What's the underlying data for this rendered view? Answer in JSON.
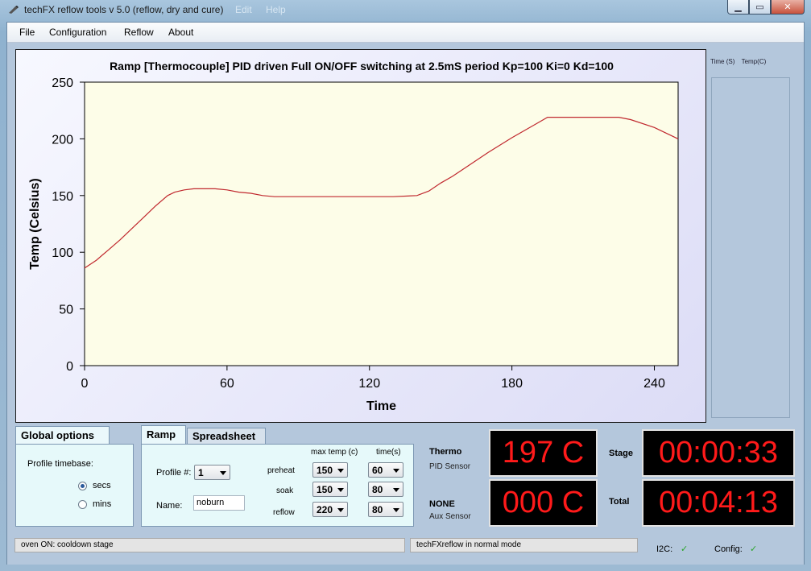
{
  "window": {
    "title": "techFX reflow tools v 5.0 (reflow, dry and cure)",
    "ghost_menu": [
      "Edit",
      "Help"
    ],
    "btn_min": "▁",
    "btn_max": "▭",
    "btn_close": "✕"
  },
  "menu": [
    "File",
    "Configuration",
    "Reflow",
    "About"
  ],
  "chart_data": {
    "type": "line",
    "title": "Ramp [Thermocouple] PID driven Full ON/OFF switching at 2.5mS period  Kp=100 Ki=0 Kd=100",
    "xlabel": "Time",
    "ylabel": "Temp (Celsius)",
    "xlim": [
      0,
      250
    ],
    "ylim": [
      0,
      250
    ],
    "xticks": [
      0,
      60,
      120,
      180,
      240
    ],
    "yticks": [
      0,
      50,
      100,
      150,
      200,
      250
    ],
    "grid": false,
    "line_color": "#c0282e",
    "plot_background": "#fdfde8",
    "series": [
      {
        "x": [
          0,
          5,
          10,
          15,
          20,
          25,
          30,
          35,
          38,
          42,
          46,
          50,
          55,
          60,
          65,
          70,
          75,
          80,
          90,
          100,
          110,
          120,
          130,
          140,
          145,
          150,
          155,
          160,
          170,
          180,
          190,
          195,
          200,
          210,
          220,
          225,
          230,
          240,
          250
        ],
        "y": [
          86,
          93,
          102,
          111,
          121,
          131,
          141,
          150,
          153,
          155,
          156,
          156,
          156,
          155,
          153,
          152,
          150,
          149,
          149,
          149,
          149,
          149,
          149,
          150,
          154,
          161,
          167,
          174,
          188,
          201,
          213,
          219,
          219,
          219,
          219,
          219,
          217,
          210,
          200
        ]
      }
    ]
  },
  "side_panel": {
    "col_time": "Time (S)",
    "col_temp": "Temp(C)"
  },
  "global_options": {
    "tab": "Global options",
    "timebase_label": "Profile timebase:",
    "opt_secs": "secs",
    "opt_mins": "mins"
  },
  "ramp": {
    "tab_ramp": "Ramp",
    "tab_spreadsheet": "Spreadsheet",
    "profile_label": "Profile #:",
    "profile_value": "1",
    "name_label": "Name:",
    "name_value": "noburn",
    "col_maxtemp": "max temp (c)",
    "col_time": "time(s)",
    "rows": [
      {
        "label": "preheat",
        "temp": "150",
        "time": "60"
      },
      {
        "label": "soak",
        "temp": "150",
        "time": "80"
      },
      {
        "label": "reflow",
        "temp": "220",
        "time": "80"
      }
    ]
  },
  "sensors": {
    "thermo_title": "Thermo",
    "thermo_sub": "PID Sensor",
    "thermo_value": "197 C",
    "aux_title": "NONE",
    "aux_sub": "Aux Sensor",
    "aux_value": "000 C",
    "stage_label": "Stage",
    "stage_value": "00:00:33",
    "total_label": "Total",
    "total_value": "00:04:13"
  },
  "status": {
    "left": "oven ON:  cooldown stage",
    "mid": "techFXreflow in normal mode",
    "i2c_label": "I2C:",
    "config_label": "Config:",
    "check": "✓"
  }
}
